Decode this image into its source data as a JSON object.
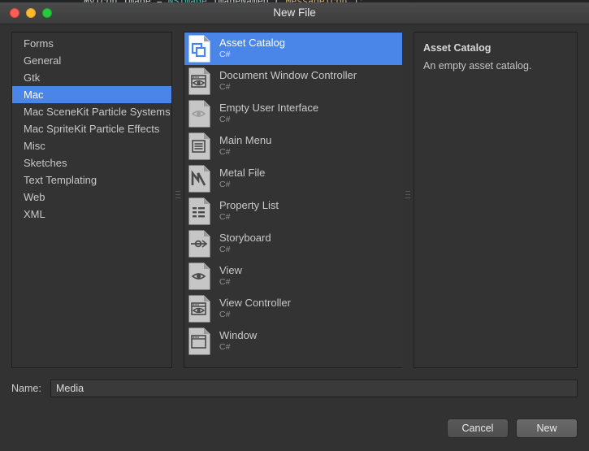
{
  "editor_background": {
    "code_fragment": "MyIcon.Image = NSImage.ImageNamed (\"MessageIcon\");",
    "segments": [
      {
        "text": "MyIcon.Image = ",
        "kind": "plain"
      },
      {
        "text": "NSImage",
        "kind": "type"
      },
      {
        "text": ".ImageNamed (",
        "kind": "plain"
      },
      {
        "text": "\"MessageIcon\"",
        "kind": "str"
      },
      {
        "text": ");",
        "kind": "punc"
      }
    ]
  },
  "window": {
    "title": "New File",
    "controls": {
      "close": "close-button",
      "minimize": "minimize-button",
      "zoom": "zoom-button"
    }
  },
  "sidebar": {
    "items": [
      {
        "label": "Forms",
        "selected": false
      },
      {
        "label": "General",
        "selected": false
      },
      {
        "label": "Gtk",
        "selected": false
      },
      {
        "label": "Mac",
        "selected": true
      },
      {
        "label": "Mac SceneKit Particle Systems",
        "selected": false
      },
      {
        "label": "Mac SpriteKit Particle Effects",
        "selected": false
      },
      {
        "label": "Misc",
        "selected": false
      },
      {
        "label": "Sketches",
        "selected": false
      },
      {
        "label": "Text Templating",
        "selected": false
      },
      {
        "label": "Web",
        "selected": false
      },
      {
        "label": "XML",
        "selected": false
      }
    ]
  },
  "templates": {
    "items": [
      {
        "title": "Asset Catalog",
        "language": "C#",
        "icon": "asset-catalog-icon",
        "selected": true
      },
      {
        "title": "Document Window Controller",
        "language": "C#",
        "icon": "document-window-controller-icon",
        "selected": false
      },
      {
        "title": "Empty User Interface",
        "language": "C#",
        "icon": "empty-user-interface-icon",
        "selected": false
      },
      {
        "title": "Main Menu",
        "language": "C#",
        "icon": "main-menu-icon",
        "selected": false
      },
      {
        "title": "Metal File",
        "language": "C#",
        "icon": "metal-file-icon",
        "selected": false
      },
      {
        "title": "Property List",
        "language": "C#",
        "icon": "property-list-icon",
        "selected": false
      },
      {
        "title": "Storyboard",
        "language": "C#",
        "icon": "storyboard-icon",
        "selected": false
      },
      {
        "title": "View",
        "language": "C#",
        "icon": "view-icon",
        "selected": false
      },
      {
        "title": "View Controller",
        "language": "C#",
        "icon": "view-controller-icon",
        "selected": false
      },
      {
        "title": "Window",
        "language": "C#",
        "icon": "window-icon",
        "selected": false
      }
    ]
  },
  "detail": {
    "title": "Asset Catalog",
    "description": "An empty asset catalog."
  },
  "name_field": {
    "label": "Name:",
    "value": "Media",
    "placeholder": ""
  },
  "footer": {
    "cancel_label": "Cancel",
    "new_label": "New"
  },
  "colors": {
    "selection_blue": "#4a86e8",
    "dialog_background": "#323232",
    "pane_background": "#333333",
    "text_primary": "#c9c9c9",
    "text_secondary": "#8e8e8e",
    "traffic_close": "#ff5f57",
    "traffic_minimize": "#febc2e",
    "traffic_zoom": "#28c840"
  }
}
